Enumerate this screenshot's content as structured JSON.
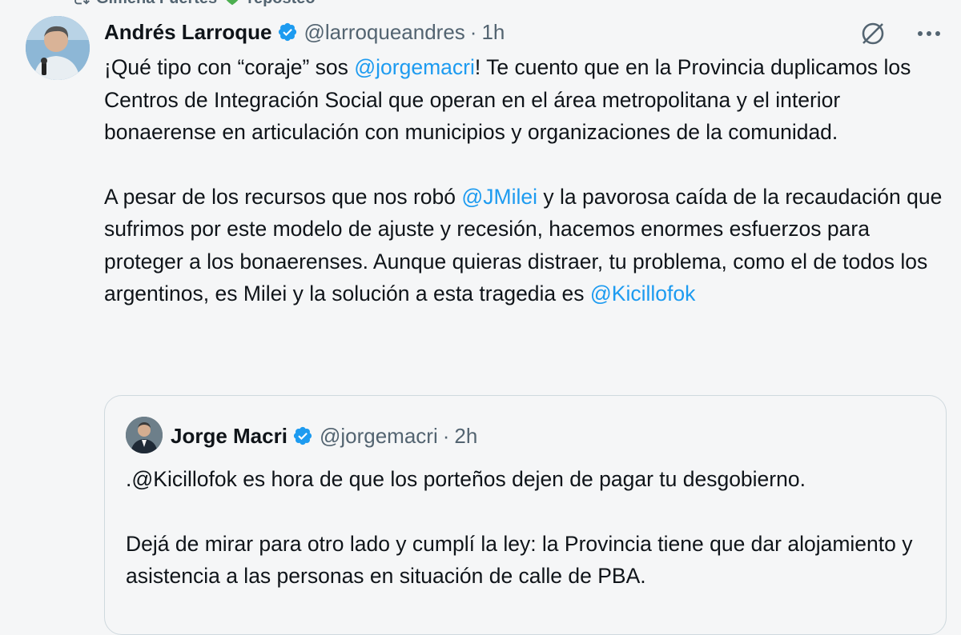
{
  "repost": {
    "user": "Gimena Fuertes",
    "label": "reposteó"
  },
  "tweet": {
    "name": "Andrés Larroque",
    "handle": "@larroqueandres",
    "dot": "·",
    "time": "1h",
    "p1": {
      "t1": "¡Qué tipo con “coraje” sos ",
      "m1": "@jorgemacri",
      "t2": "! Te cuento que en la Provincia duplicamos los Centros de Integración Social que operan en el área metropolitana y el interior bonaerense en articulación con municipios y organizaciones de la comunidad."
    },
    "p2": {
      "t1": "A pesar de los recursos que nos robó ",
      "m1": "@JMilei",
      "t2": " y la pavorosa caída de la recaudación que sufrimos por este modelo de ajuste y recesión, hacemos enormes esfuerzos para proteger a los bonaerenses. Aunque quieras distraer, tu problema, como el de todos los argentinos, es Milei y la solución a esta tragedia es ",
      "m2": "@Kicillofok"
    }
  },
  "quote": {
    "name": "Jorge Macri",
    "handle": "@jorgemacri",
    "dot": "·",
    "time": "2h",
    "p1": ".@Kicillofok es hora de que los porteños dejen de pagar tu desgobierno.",
    "p2": "Dejá de mirar para otro lado y cumplí la ley: la Provincia tiene que dar alojamiento y asistencia a las personas en situación de calle de PBA."
  },
  "icons": {
    "repost": "repost-icon",
    "verified": "verified-badge-icon",
    "grok": "grok-icon",
    "more": "more-icon"
  },
  "colors": {
    "mention": "#1d9bf0",
    "verified": "#1d9bf0",
    "repost_heart": "#4caf50"
  }
}
